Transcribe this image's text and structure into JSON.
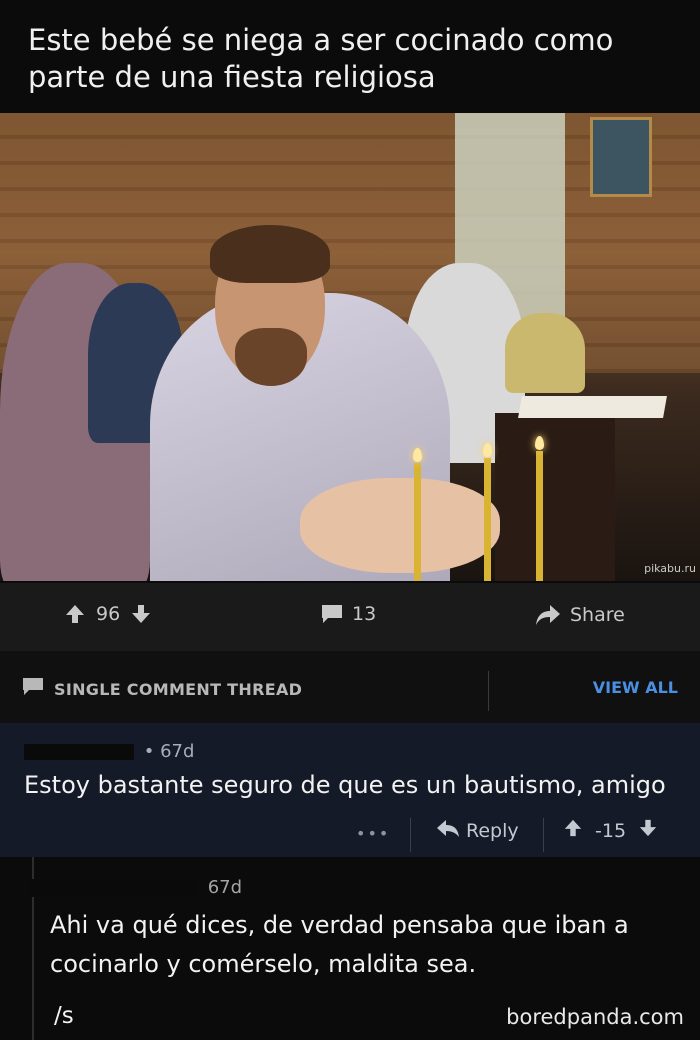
{
  "post": {
    "title": "Este bebé se niega a ser cocinado como parte de una fiesta religiosa",
    "image_watermark": "pikabu.ru"
  },
  "actions": {
    "upvotes": "96",
    "comments": "13",
    "share_label": "Share"
  },
  "thread_bar": {
    "label": "SINGLE COMMENT THREAD",
    "view_all": "VIEW ALL"
  },
  "comment1": {
    "age": "• 67d",
    "body": "Estoy bastante seguro de que es un bautismo, amigo",
    "more": "•••",
    "reply_label": "Reply",
    "score": "-15"
  },
  "comment2": {
    "age": "67d",
    "body": "Ahi va qué dices, de verdad pensaba que iban a cocinarlo y comérselo, maldita sea.",
    "signature": "/s"
  },
  "brand": "boredpanda.com",
  "colors": {
    "background": "#0b0b0b",
    "action_bar": "#1a1a1b",
    "comment_highlight": "#141a28",
    "link_blue": "#4a8fe0"
  }
}
